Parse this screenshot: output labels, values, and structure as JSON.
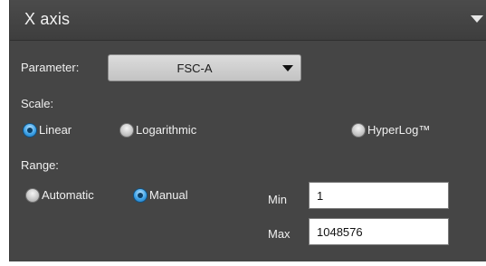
{
  "panel": {
    "title": "X axis",
    "collapse_icon": "triangle-down-icon"
  },
  "parameter": {
    "label": "Parameter:",
    "selected": "FSC-A",
    "arrow_icon": "triangle-down-icon"
  },
  "scale": {
    "label": "Scale:",
    "options": [
      {
        "label": "Linear",
        "selected": true
      },
      {
        "label": "Logarithmic",
        "selected": false
      },
      {
        "label": "HyperLog™",
        "selected": false
      }
    ]
  },
  "range": {
    "label": "Range:",
    "options": [
      {
        "label": "Automatic",
        "selected": false
      },
      {
        "label": "Manual",
        "selected": true
      }
    ],
    "min_label": "Min",
    "min_value": "1",
    "max_label": "Max",
    "max_value": "1048576"
  },
  "colors": {
    "panel_bg": "#454545",
    "header_bg": "#3e3e3e",
    "radio_selected": "#3fa3e8"
  }
}
